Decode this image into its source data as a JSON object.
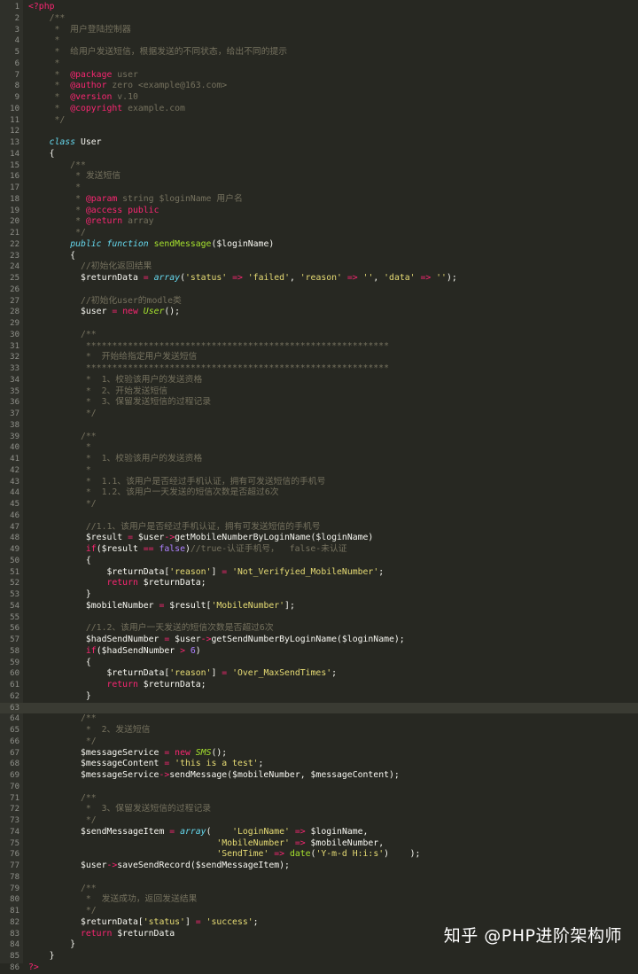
{
  "colors": {
    "background": "#272822",
    "gutter": "#2f302a",
    "comment": "#75715e",
    "keyword": "#f92672",
    "storage": "#66d9ef",
    "string": "#e6db74",
    "number": "#ae81ff",
    "function": "#a6e22e",
    "text": "#f8f8f2"
  },
  "editor": {
    "current_line": 63,
    "lines": [
      [
        [
          "tag",
          "<?php"
        ]
      ],
      [
        [
          "cm",
          "    /**"
        ]
      ],
      [
        [
          "cm",
          "     *  用户登陆控制器"
        ]
      ],
      [
        [
          "cm",
          "     *"
        ]
      ],
      [
        [
          "cm",
          "     *  给用户发送短信，根据发送的不同状态，给出不同的提示"
        ]
      ],
      [
        [
          "cm",
          "     *"
        ]
      ],
      [
        [
          "cm",
          "     *  "
        ],
        [
          "tag",
          "@package"
        ],
        [
          "cm",
          " user"
        ]
      ],
      [
        [
          "cm",
          "     *  "
        ],
        [
          "tag",
          "@author"
        ],
        [
          "cm",
          " zero <example@163.com>"
        ]
      ],
      [
        [
          "cm",
          "     *  "
        ],
        [
          "tag",
          "@version"
        ],
        [
          "cm",
          " v.10"
        ]
      ],
      [
        [
          "cm",
          "     *  "
        ],
        [
          "tag",
          "@copyright"
        ],
        [
          "cm",
          " example.com"
        ]
      ],
      [
        [
          "cm",
          "     */"
        ]
      ],
      [],
      [
        [
          "pl",
          "    "
        ],
        [
          "stg",
          "class"
        ],
        [
          "pl",
          " User"
        ]
      ],
      [
        [
          "pl",
          "    {"
        ]
      ],
      [
        [
          "cm",
          "        /**"
        ]
      ],
      [
        [
          "cm",
          "         * 发送短信"
        ]
      ],
      [
        [
          "cm",
          "         *"
        ]
      ],
      [
        [
          "cm",
          "         * "
        ],
        [
          "tag",
          "@param"
        ],
        [
          "cm",
          " string $loginName 用户名"
        ]
      ],
      [
        [
          "cm",
          "         * "
        ],
        [
          "tag",
          "@access"
        ],
        [
          "cm",
          " "
        ],
        [
          "tag",
          "public"
        ]
      ],
      [
        [
          "cm",
          "         * "
        ],
        [
          "tag",
          "@return"
        ],
        [
          "cm",
          " array"
        ]
      ],
      [
        [
          "cm",
          "         */"
        ]
      ],
      [
        [
          "pl",
          "        "
        ],
        [
          "stg",
          "public"
        ],
        [
          "pl",
          " "
        ],
        [
          "stg",
          "function"
        ],
        [
          "pl",
          " "
        ],
        [
          "fn",
          "sendMessage"
        ],
        [
          "pl",
          "($loginName)"
        ]
      ],
      [
        [
          "pl",
          "        {"
        ]
      ],
      [
        [
          "cm",
          "          //初始化返回结果"
        ]
      ],
      [
        [
          "pl",
          "          $returnData "
        ],
        [
          "op",
          "="
        ],
        [
          "pl",
          " "
        ],
        [
          "stg",
          "array"
        ],
        [
          "pl",
          "("
        ],
        [
          "str",
          "'status'"
        ],
        [
          "pl",
          " "
        ],
        [
          "op",
          "=>"
        ],
        [
          "pl",
          " "
        ],
        [
          "str",
          "'failed'"
        ],
        [
          "pl",
          ", "
        ],
        [
          "str",
          "'reason'"
        ],
        [
          "pl",
          " "
        ],
        [
          "op",
          "=>"
        ],
        [
          "pl",
          " "
        ],
        [
          "str",
          "''"
        ],
        [
          "pl",
          ", "
        ],
        [
          "str",
          "'data'"
        ],
        [
          "pl",
          " "
        ],
        [
          "op",
          "=>"
        ],
        [
          "pl",
          " "
        ],
        [
          "str",
          "''"
        ],
        [
          "pl",
          ");"
        ]
      ],
      [],
      [
        [
          "cm",
          "          //初始化user的modle类"
        ]
      ],
      [
        [
          "pl",
          "          $user "
        ],
        [
          "op",
          "="
        ],
        [
          "pl",
          " "
        ],
        [
          "kw",
          "new"
        ],
        [
          "pl",
          " "
        ],
        [
          "cls",
          "User"
        ],
        [
          "pl",
          "();"
        ]
      ],
      [],
      [
        [
          "cm",
          "          /**"
        ]
      ],
      [
        [
          "cm",
          "           **********************************************************"
        ]
      ],
      [
        [
          "cm",
          "           *  开始给指定用户发送短信"
        ]
      ],
      [
        [
          "cm",
          "           **********************************************************"
        ]
      ],
      [
        [
          "cm",
          "           *  1、校验该用户的发送资格"
        ]
      ],
      [
        [
          "cm",
          "           *  2、开始发送短信"
        ]
      ],
      [
        [
          "cm",
          "           *  3、保留发送短信的过程记录"
        ]
      ],
      [
        [
          "cm",
          "           */"
        ]
      ],
      [],
      [
        [
          "cm",
          "          /**"
        ]
      ],
      [
        [
          "cm",
          "           *"
        ]
      ],
      [
        [
          "cm",
          "           *  1、校验该用户的发送资格"
        ]
      ],
      [
        [
          "cm",
          "           *"
        ]
      ],
      [
        [
          "cm",
          "           *  1.1、该用户是否经过手机认证，拥有可发送短信的手机号"
        ]
      ],
      [
        [
          "cm",
          "           *  1.2、该用户一天发送的短信次数是否超过6次"
        ]
      ],
      [
        [
          "cm",
          "           */"
        ]
      ],
      [],
      [
        [
          "cm",
          "           //1.1、该用户是否经过手机认证，拥有可发送短信的手机号"
        ]
      ],
      [
        [
          "pl",
          "           $result "
        ],
        [
          "op",
          "="
        ],
        [
          "pl",
          " $user"
        ],
        [
          "op",
          "->"
        ],
        [
          "pl",
          "getMobileNumberByLoginName($loginName)"
        ]
      ],
      [
        [
          "pl",
          "           "
        ],
        [
          "kw",
          "if"
        ],
        [
          "pl",
          "($result "
        ],
        [
          "op",
          "=="
        ],
        [
          "pl",
          " "
        ],
        [
          "num",
          "false"
        ],
        [
          "pl",
          ")"
        ],
        [
          "cm",
          "//true-认证手机号，  false-未认证"
        ]
      ],
      [
        [
          "pl",
          "           {"
        ]
      ],
      [
        [
          "pl",
          "               $returnData["
        ],
        [
          "str",
          "'reason'"
        ],
        [
          "pl",
          "] "
        ],
        [
          "op",
          "="
        ],
        [
          "pl",
          " "
        ],
        [
          "str",
          "'Not_Verifyied_MobileNumber'"
        ],
        [
          "pl",
          ";"
        ]
      ],
      [
        [
          "pl",
          "               "
        ],
        [
          "kw",
          "return"
        ],
        [
          "pl",
          " $returnData;"
        ]
      ],
      [
        [
          "pl",
          "           }"
        ]
      ],
      [
        [
          "pl",
          "           $mobileNumber "
        ],
        [
          "op",
          "="
        ],
        [
          "pl",
          " $result["
        ],
        [
          "str",
          "'MobileNumber'"
        ],
        [
          "pl",
          "];"
        ]
      ],
      [],
      [
        [
          "cm",
          "           //1.2、该用户一天发送的短信次数是否超过6次"
        ]
      ],
      [
        [
          "pl",
          "           $hadSendNumber "
        ],
        [
          "op",
          "="
        ],
        [
          "pl",
          " $user"
        ],
        [
          "op",
          "->"
        ],
        [
          "pl",
          "getSendNumberByLoginName($loginName);"
        ]
      ],
      [
        [
          "pl",
          "           "
        ],
        [
          "kw",
          "if"
        ],
        [
          "pl",
          "($hadSendNumber "
        ],
        [
          "op",
          ">"
        ],
        [
          "pl",
          " "
        ],
        [
          "num",
          "6"
        ],
        [
          "pl",
          ")"
        ]
      ],
      [
        [
          "pl",
          "           {"
        ]
      ],
      [
        [
          "pl",
          "               $returnData["
        ],
        [
          "str",
          "'reason'"
        ],
        [
          "pl",
          "] "
        ],
        [
          "op",
          "="
        ],
        [
          "pl",
          " "
        ],
        [
          "str",
          "'Over_MaxSendTimes'"
        ],
        [
          "pl",
          ";"
        ]
      ],
      [
        [
          "pl",
          "               "
        ],
        [
          "kw",
          "return"
        ],
        [
          "pl",
          " $returnData;"
        ]
      ],
      [
        [
          "pl",
          "           }"
        ]
      ],
      [],
      [
        [
          "cm",
          "          /**"
        ]
      ],
      [
        [
          "cm",
          "           *  2、发送短信"
        ]
      ],
      [
        [
          "cm",
          "           */"
        ]
      ],
      [
        [
          "pl",
          "          $messageService "
        ],
        [
          "op",
          "="
        ],
        [
          "pl",
          " "
        ],
        [
          "kw",
          "new"
        ],
        [
          "pl",
          " "
        ],
        [
          "cls",
          "SMS"
        ],
        [
          "pl",
          "();"
        ]
      ],
      [
        [
          "pl",
          "          $messageContent "
        ],
        [
          "op",
          "="
        ],
        [
          "pl",
          " "
        ],
        [
          "str",
          "'this is a test'"
        ],
        [
          "pl",
          ";"
        ]
      ],
      [
        [
          "pl",
          "          $messageService"
        ],
        [
          "op",
          "->"
        ],
        [
          "pl",
          "sendMessage($mobileNumber, $messageContent);"
        ]
      ],
      [],
      [
        [
          "cm",
          "          /**"
        ]
      ],
      [
        [
          "cm",
          "           *  3、保留发送短信的过程记录"
        ]
      ],
      [
        [
          "cm",
          "           */"
        ]
      ],
      [
        [
          "pl",
          "          $sendMessageItem "
        ],
        [
          "op",
          "="
        ],
        [
          "pl",
          " "
        ],
        [
          "stg",
          "array"
        ],
        [
          "pl",
          "(    "
        ],
        [
          "str",
          "'LoginName'"
        ],
        [
          "pl",
          " "
        ],
        [
          "op",
          "=>"
        ],
        [
          "pl",
          " $loginName,"
        ]
      ],
      [
        [
          "pl",
          "                                    "
        ],
        [
          "str",
          "'MobileNumber'"
        ],
        [
          "pl",
          " "
        ],
        [
          "op",
          "=>"
        ],
        [
          "pl",
          " $mobileNumber,"
        ]
      ],
      [
        [
          "pl",
          "                                    "
        ],
        [
          "str",
          "'SendTime'"
        ],
        [
          "pl",
          " "
        ],
        [
          "op",
          "=>"
        ],
        [
          "pl",
          " "
        ],
        [
          "fn",
          "date"
        ],
        [
          "pl",
          "("
        ],
        [
          "str",
          "'Y-m-d H:i:s'"
        ],
        [
          "pl",
          ")    );"
        ]
      ],
      [
        [
          "pl",
          "          $user"
        ],
        [
          "op",
          "->"
        ],
        [
          "pl",
          "saveSendRecord($sendMessageItem);"
        ]
      ],
      [],
      [
        [
          "cm",
          "          /**"
        ]
      ],
      [
        [
          "cm",
          "           *  发送成功，返回发送结果"
        ]
      ],
      [
        [
          "cm",
          "           */"
        ]
      ],
      [
        [
          "pl",
          "          $returnData["
        ],
        [
          "str",
          "'status'"
        ],
        [
          "pl",
          "] "
        ],
        [
          "op",
          "="
        ],
        [
          "pl",
          " "
        ],
        [
          "str",
          "'success'"
        ],
        [
          "pl",
          ";"
        ]
      ],
      [
        [
          "pl",
          "          "
        ],
        [
          "kw",
          "return"
        ],
        [
          "pl",
          " $returnData"
        ]
      ],
      [
        [
          "pl",
          "        }"
        ]
      ],
      [
        [
          "pl",
          "    }"
        ]
      ],
      [
        [
          "tag",
          "?>"
        ]
      ]
    ]
  },
  "watermark": {
    "text": "知乎 @PHP进阶架构师"
  }
}
